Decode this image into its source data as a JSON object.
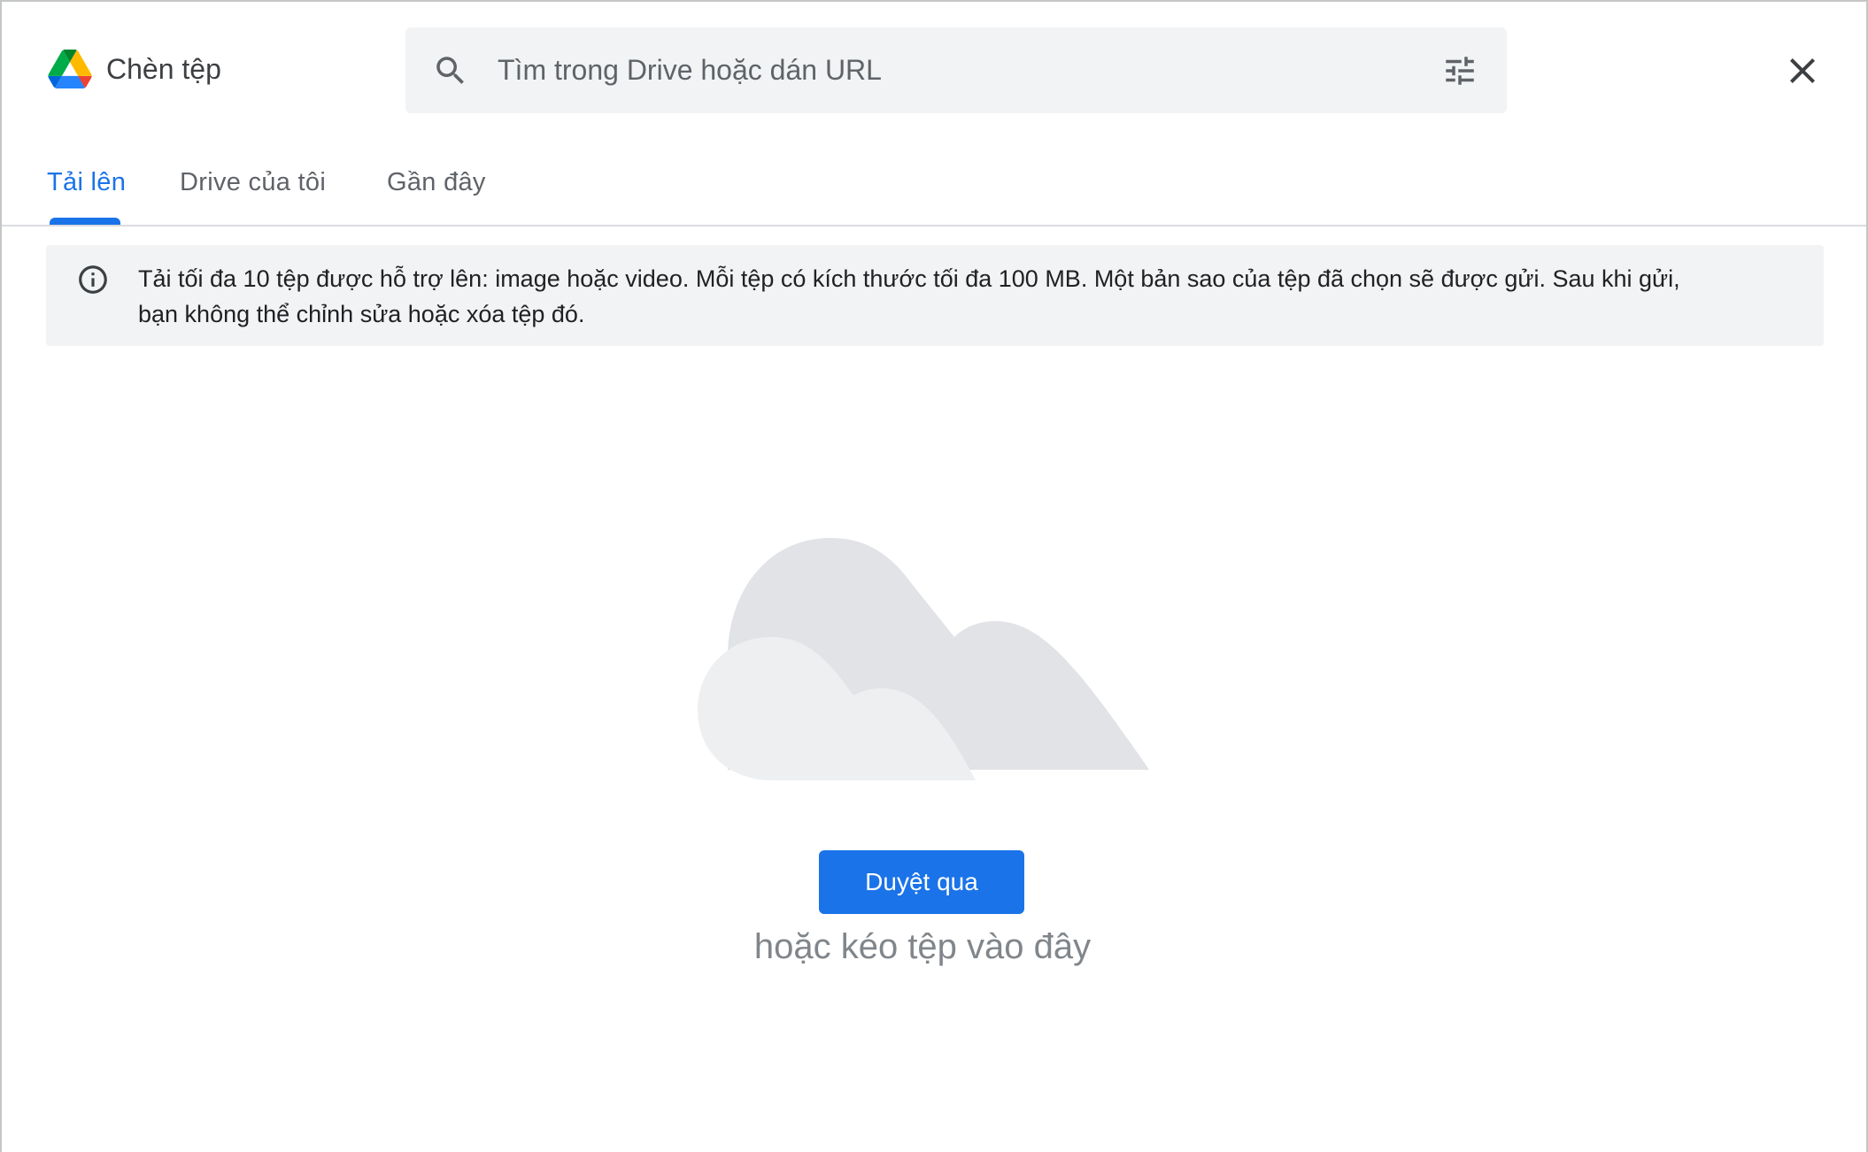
{
  "header": {
    "title": "Chèn tệp",
    "logo_icon": "google-drive-icon",
    "search": {
      "placeholder": "Tìm trong Drive hoặc dán URL",
      "value": "",
      "icon": "search-icon"
    },
    "filter_icon": "tune-icon",
    "close_icon": "close-icon"
  },
  "tabs": [
    {
      "label": "Tải lên",
      "active": true
    },
    {
      "label": "Drive của tôi",
      "active": false
    },
    {
      "label": "Gần đây",
      "active": false
    }
  ],
  "info_banner": {
    "icon": "info-icon",
    "line1": "Tải tối đa 10 tệp được hỗ trợ lên: image hoặc video. Mỗi tệp có kích thước tối đa 100 MB. Một bản sao của tệp đã chọn sẽ được gửi. Sau khi gửi,",
    "line2": "bạn không thể chỉnh sửa hoặc xóa tệp đó."
  },
  "upload": {
    "illustration": "cloud-illustration",
    "browse_label": "Duyệt qua",
    "drag_hint": "hoặc kéo tệp vào đây"
  },
  "colors": {
    "accent": "#1a73e8",
    "banner_bg": "#f1f3f4",
    "text_primary": "#202124",
    "text_secondary": "#5f6368",
    "cloud_back": "#e1e3e6",
    "cloud_front": "#eeeff1"
  }
}
